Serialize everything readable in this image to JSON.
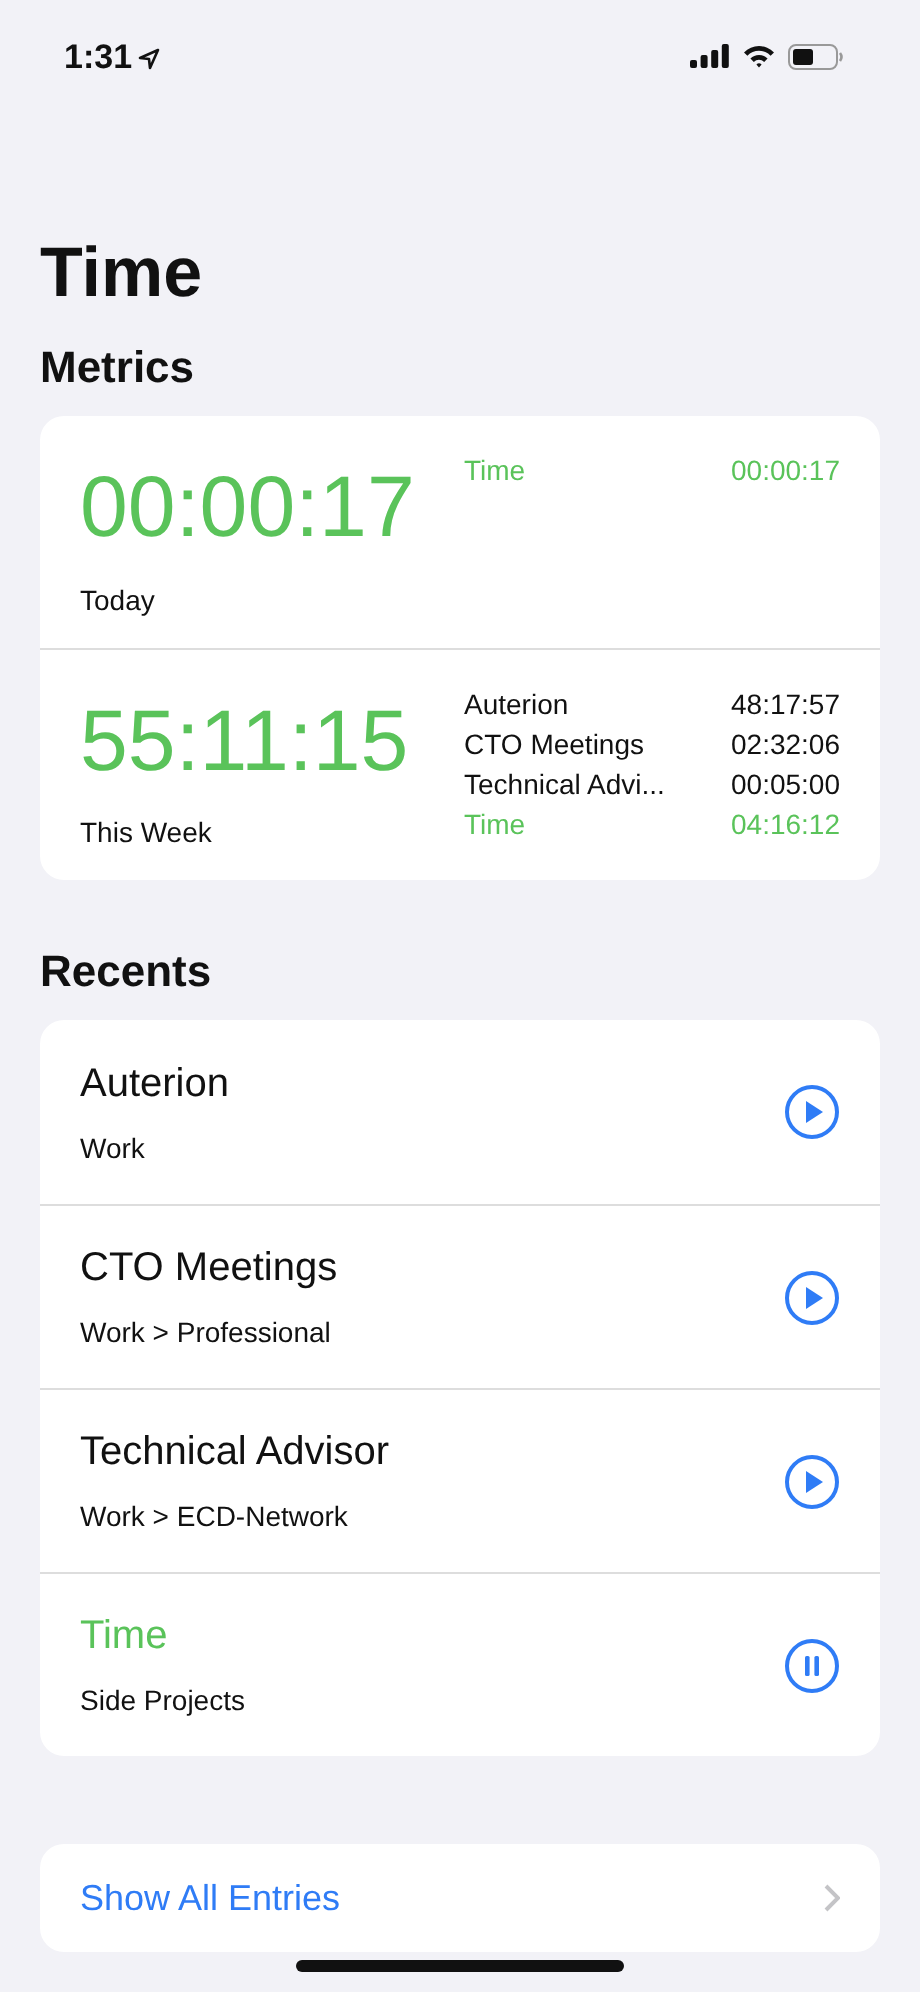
{
  "status_bar": {
    "time": "1:31"
  },
  "title": "Time",
  "metrics": {
    "heading": "Metrics",
    "periods": [
      {
        "total": "00:00:17",
        "label": "Today",
        "breakdown": [
          {
            "name": "Time",
            "duration": "00:00:17",
            "running": true
          }
        ]
      },
      {
        "total": "55:11:15",
        "label": "This Week",
        "breakdown": [
          {
            "name": "Auterion",
            "duration": "48:17:57",
            "running": false
          },
          {
            "name": "CTO Meetings",
            "duration": "02:32:06",
            "running": false
          },
          {
            "name": "Technical Advi...",
            "duration": "00:05:00",
            "running": false
          },
          {
            "name": "Time",
            "duration": "04:16:12",
            "running": true
          }
        ]
      }
    ]
  },
  "recents": {
    "heading": "Recents",
    "items": [
      {
        "name": "Auterion",
        "category": "Work",
        "running": false
      },
      {
        "name": "CTO Meetings",
        "category": "Work > Professional",
        "running": false
      },
      {
        "name": "Technical Advisor",
        "category": "Work > ECD-Network",
        "running": false
      },
      {
        "name": "Time",
        "category": "Side Projects",
        "running": true
      }
    ]
  },
  "show_all": {
    "label": "Show All Entries"
  }
}
